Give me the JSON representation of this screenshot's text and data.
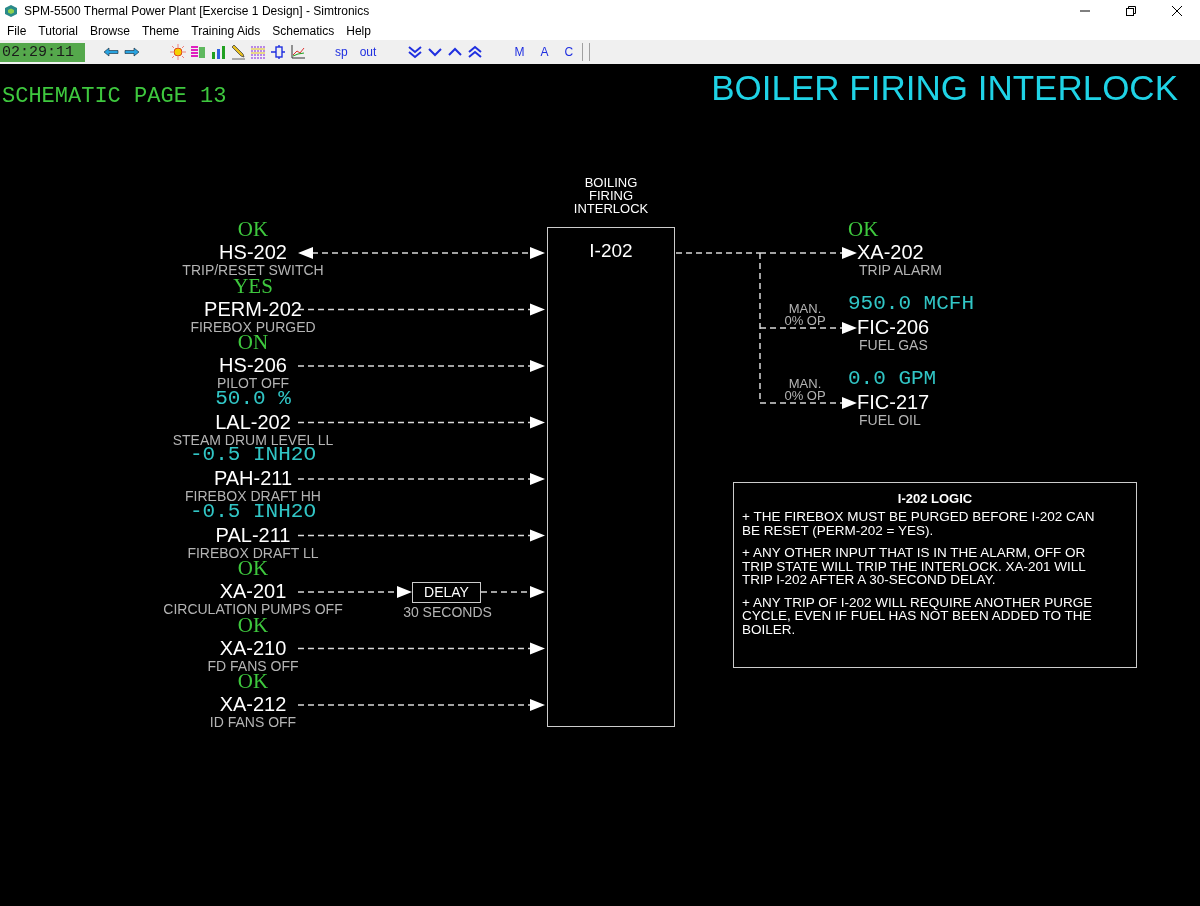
{
  "window": {
    "title": "SPM-5500 Thermal Power Plant [Exercise 1 Design] - Simtronics"
  },
  "menu": [
    "File",
    "Tutorial",
    "Browse",
    "Theme",
    "Training Aids",
    "Schematics",
    "Help"
  ],
  "toolbar": {
    "clock": "02:29:11",
    "text_buttons": [
      "sp",
      "out"
    ],
    "mode_buttons": [
      "M",
      "A",
      "C"
    ]
  },
  "page_label": "SCHEMATIC PAGE 13",
  "heading": "BOILER FIRING INTERLOCK",
  "interlock": {
    "title": "BOILING FIRING INTERLOCK",
    "tag": "I-202"
  },
  "inputs": [
    {
      "status": "OK",
      "kind": "discrete",
      "tag": "HS-202",
      "desc": "TRIP/RESET SWITCH",
      "bidirectional": true
    },
    {
      "status": "YES",
      "kind": "discrete",
      "tag": "PERM-202",
      "desc": "FIREBOX PURGED",
      "bidirectional": false
    },
    {
      "status": "ON",
      "kind": "discrete",
      "tag": "HS-206",
      "desc": "PILOT OFF",
      "bidirectional": false
    },
    {
      "status": "50.0 %",
      "kind": "analog",
      "tag": "LAL-202",
      "desc": "STEAM DRUM LEVEL LL",
      "bidirectional": false
    },
    {
      "status": "-0.5 INH2O",
      "kind": "analog",
      "tag": "PAH-211",
      "desc": "FIREBOX DRAFT HH",
      "bidirectional": false
    },
    {
      "status": "-0.5 INH2O",
      "kind": "analog",
      "tag": "PAL-211",
      "desc": "FIREBOX DRAFT LL",
      "bidirectional": false
    },
    {
      "status": "OK",
      "kind": "discrete",
      "tag": "XA-201",
      "desc": "CIRCULATION PUMPS OFF",
      "bidirectional": false,
      "delay": {
        "label": "DELAY",
        "time": "30 SECONDS"
      }
    },
    {
      "status": "OK",
      "kind": "discrete",
      "tag": "XA-210",
      "desc": "FD FANS OFF",
      "bidirectional": false
    },
    {
      "status": "OK",
      "kind": "discrete",
      "tag": "XA-212",
      "desc": "ID FANS OFF",
      "bidirectional": false
    }
  ],
  "outputs": [
    {
      "status": "OK",
      "kind": "discrete",
      "tag": "XA-202",
      "desc": "TRIP ALARM"
    },
    {
      "status": "950.0 MCFH",
      "kind": "analog",
      "tag": "FIC-206",
      "desc": "FUEL GAS",
      "mode": "MAN.",
      "output": "0% OP"
    },
    {
      "status": "0.0 GPM",
      "kind": "analog",
      "tag": "FIC-217",
      "desc": "FUEL OIL",
      "mode": "MAN.",
      "output": "0% OP"
    }
  ],
  "logic": {
    "title": "I-202 LOGIC",
    "paragraphs": [
      "+ THE FIREBOX MUST BE PURGED BEFORE I-202 CAN BE RESET (PERM-202 = YES).",
      "+ ANY OTHER INPUT THAT IS IN THE ALARM, OFF OR TRIP STATE WILL TRIP THE INTERLOCK. XA-201 WILL TRIP I-202 AFTER A 30-SECOND DELAY.",
      "+ ANY TRIP OF I-202 WILL REQUIRE ANOTHER PURGE CYCLE, EVEN IF FUEL HAS NOT BEEN ADDED TO THE BOILER."
    ]
  }
}
